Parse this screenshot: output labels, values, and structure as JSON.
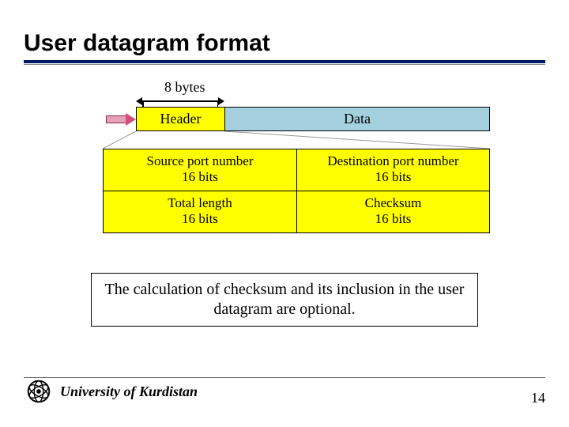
{
  "title": "User datagram format",
  "diagram": {
    "bytes_label": "8 bytes",
    "header_label": "Header",
    "data_label": "Data",
    "fields": [
      [
        {
          "name": "Source port number",
          "bits": "16 bits"
        },
        {
          "name": "Destination port number",
          "bits": "16 bits"
        }
      ],
      [
        {
          "name": "Total length",
          "bits": "16 bits"
        },
        {
          "name": "Checksum",
          "bits": "16 bits"
        }
      ]
    ]
  },
  "note": "The calculation of checksum and its inclusion in the user datagram are optional.",
  "footer": {
    "institution": "University of Kurdistan",
    "page_number": "14"
  }
}
